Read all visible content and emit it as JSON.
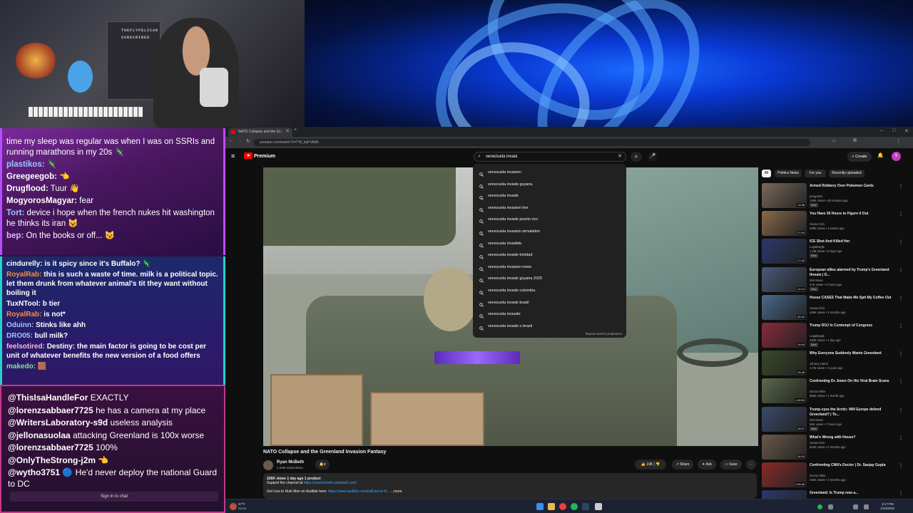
{
  "webcam": {
    "sign_line1": "THEFLYPELICAN",
    "sign_line2": "SUBSCRIBED"
  },
  "chat": {
    "top_messages": [
      {
        "user": "",
        "text": "time my sleep was regular was when I was on SSRIs and running marathons in my 20s 🦎",
        "color": "#ffffff"
      },
      {
        "user": "plastikos:",
        "text": "🦎",
        "color": "#9ec7ff"
      },
      {
        "user": "Greegeegob:",
        "text": "👈",
        "color": "#ffffff"
      },
      {
        "user": "Drugflood:",
        "text": "Tuur 👋",
        "color": "#ffffff"
      },
      {
        "user": "MogyorosMagyar:",
        "text": "fear",
        "color": "#ffffff"
      },
      {
        "user": "Tort:",
        "text": "device i hope when the french nukes hit washington he thinks its iran 😺",
        "color": "#9ec7ff"
      },
      {
        "user": "bep:",
        "text": "On the books or off... 😼",
        "color": "#d8b8ff"
      }
    ],
    "mid_messages": [
      {
        "user": "cindurelly:",
        "text": "is it spicy since it's Buffalo? 🦎",
        "color": "#ffffff"
      },
      {
        "user": "RoyalRab:",
        "text": "this is such a waste of time. milk is a political topic. let them drunk from whatever animal's tit they want without boiling it",
        "color": "#ff8a3a"
      },
      {
        "user": "TuxNTool:",
        "text": "b tier",
        "color": "#ffffff"
      },
      {
        "user": "RoyalRab:",
        "text": "is not*",
        "color": "#ff8a3a"
      },
      {
        "user": "Oduinn:",
        "text": "Stinks like ahh",
        "color": "#9ec7ff"
      },
      {
        "user": "DRO05:",
        "text": "bull milk?",
        "color": "#9ec7ff"
      },
      {
        "user": "feelsotired:",
        "text": "Destiny: the main factor is going to be cost per unit of whatever benefits the new version of a food offers",
        "color": "#ffb8d8"
      },
      {
        "user": "makedo:",
        "text": "🟫",
        "color": "#7fe3a4"
      }
    ],
    "bottom_messages": [
      {
        "user": "@ThisIsaHandleFor",
        "text": "EXACTLY"
      },
      {
        "user": "@lorenzsabbaer7725",
        "text": "he has a camera at my place"
      },
      {
        "user": "@WritersLaboratory-s9d",
        "text": "useless analysis"
      },
      {
        "user": "@jellonasuolaa",
        "text": "attacking Greenland is 100x worse"
      },
      {
        "user": "@lorenzsabbaer7725",
        "text": "100%"
      },
      {
        "user": "@OnlyTheStrong-j2m",
        "text": "👈"
      },
      {
        "user": "@wytho3751",
        "text": "🔵 He'd never deploy the national Guard to DC"
      }
    ],
    "sign_in": "Sign in to chat"
  },
  "browser": {
    "tab_title": "NATO Collapse and the Gr...",
    "url": "youtube.com/watch?v=TW_kqPcBdIk",
    "brand": "Premium",
    "search_value": "venezuela invasi",
    "create_label": "Create",
    "avatar_letter": "S"
  },
  "suggestions": [
    "venezuela invasion",
    "venezuela invade guyana",
    "venezuela invade",
    "venezuela invasion live",
    "venezuela invade puerto rico",
    "venezuela invasion simulation",
    "venezuela invadida",
    "venezuela invade trinidad",
    "venezuela invasion news",
    "venezuela invade guyana 2025",
    "venezuela invade colombia",
    "venezuela invade brasil",
    "venezuela invasão",
    "venezuela invade o brasil"
  ],
  "report_label": "Report search predictions",
  "video": {
    "title": "NATO Collapse and the Greenland Invasion Fantasy",
    "channel": "Ryan McBeth",
    "subscribers": "1.04M subscribers",
    "likes": "19K",
    "share": "Share",
    "ask": "Ask",
    "save": "Save",
    "desc_line1": "226K views  1 day ago  1 product",
    "desc_line2_prefix": "Support the channel at ",
    "desc_line2_link": "https://ryanmcbeth.substack.com/",
    "desc_line3_prefix": "Get Lies to Rule Men on Audible here: ",
    "desc_line3_link": "https://www.audible.com/pd/Lies-to-R...",
    "desc_more": "...more"
  },
  "chips": [
    "All",
    "Politics News",
    "For you",
    "Recently uploaded"
  ],
  "recommendations": [
    {
      "title": "Armed Robbery Over Pokemon Cards",
      "channel": "pengulnO",
      "meta": "105K views • 30 minutes ago",
      "badge": "New",
      "duration": "13:38",
      "color": "#7a6a5a"
    },
    {
      "title": "You Have 36 Hours to Figure it Out",
      "channel": "House M.D.",
      "meta": "209K views • 4 weeks ago",
      "badge": "",
      "duration": "27:43",
      "color": "#8a6a4a"
    },
    {
      "title": "ICE Shot And Killed Her",
      "channel": "LegalEagle",
      "meta": "1.2M views • 8 days ago",
      "badge": "New",
      "duration": "27:43",
      "color": "#2a3a6a"
    },
    {
      "title": "European allies alarmed by Trump's Greenland threats | D...",
      "channel": "DW News",
      "meta": "47K views • 3 hours ago",
      "badge": "New",
      "duration": "11:14",
      "color": "#4a5a7a"
    },
    {
      "title": "House CASES That Made Me Spit My Coffee Out",
      "channel": "House M.D.",
      "meta": "449K views • 2 months ago",
      "badge": "",
      "duration": "30:42",
      "color": "#4a6a8a"
    },
    {
      "title": "Trump DOJ In Contempt of Congress",
      "channel": "LegalEagle",
      "meta": "340K views • 1 day ago",
      "badge": "New",
      "duration": "19:45",
      "color": "#8a2a3a"
    },
    {
      "title": "Why Everyone Suddenly Wants Greenland",
      "channel": "Johnny Harris",
      "meta": "4.7M views • 2 years ago",
      "badge": "",
      "duration": "20:48",
      "color": "#3a4a2a"
    },
    {
      "title": "Confronting Dr. Amen On His Viral Brain Scans",
      "channel": "Doctor Mike",
      "meta": "668K views • 1 month ago",
      "badge": "",
      "duration": "1:06:53",
      "color": "#5a6a4a"
    },
    {
      "title": "Trump eyes the Arctic: Will Europe defend Greenland? | To...",
      "channel": "DW News",
      "meta": "38K views • 7 hours ago",
      "badge": "New",
      "duration": "26:07",
      "color": "#3a4a6a"
    },
    {
      "title": "What's Wrong with House?",
      "channel": "House M.D.",
      "meta": "823K views • 8 months ago",
      "badge": "",
      "duration": "30:29",
      "color": "#6a5a4a"
    },
    {
      "title": "Confronting CNN's Doctor | Dr. Sanjay Gupta",
      "channel": "Doctor Mike",
      "meta": "260K views • 2 months ago",
      "badge": "",
      "duration": "2:05:45",
      "color": "#8a2a2a"
    },
    {
      "title": "Greenland: Is Trump now a...",
      "channel": "",
      "meta": "",
      "badge": "",
      "duration": "",
      "color": "#2a3a6a"
    }
  ],
  "taskbar": {
    "weather_temp": "57°F",
    "weather_desc": "Snow",
    "time": "3:17 PM",
    "date": "1/15/2026"
  },
  "colors": {
    "accent_red": "#ff0000",
    "chat_purple": "#b84cff",
    "chat_teal": "#24d2c8",
    "chat_pink": "#c23a8a",
    "link_blue": "#3ea6ff"
  }
}
